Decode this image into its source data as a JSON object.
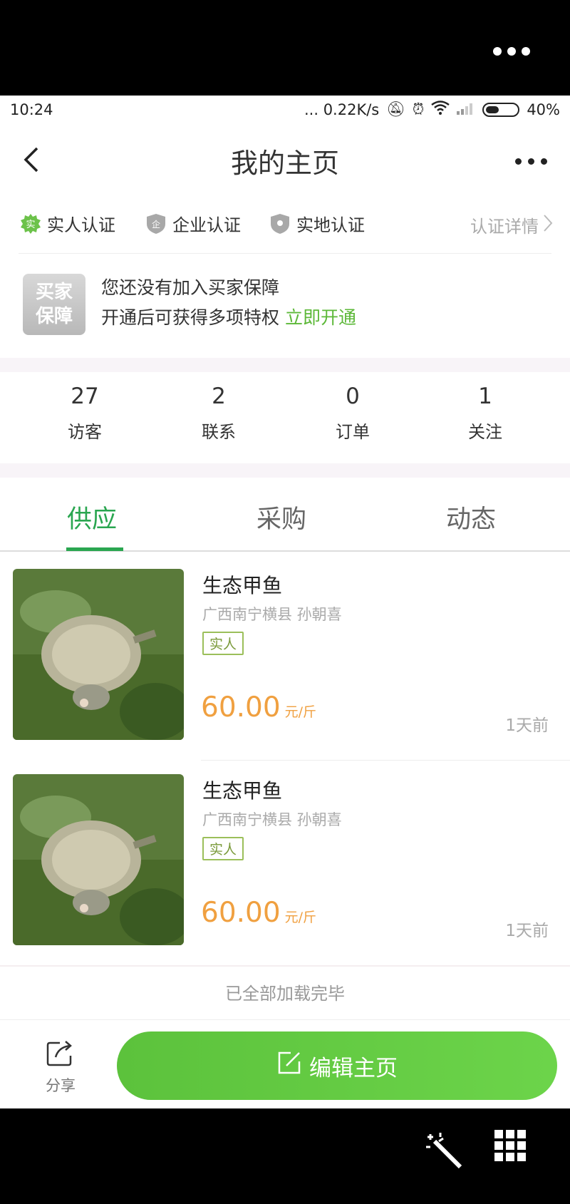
{
  "status_bar": {
    "time": "10:24",
    "network_speed": "... 0.22K/s",
    "battery": "40%"
  },
  "nav": {
    "title": "我的主页"
  },
  "certifications": {
    "items": [
      {
        "badge": "实",
        "label": "实人认证",
        "color": "#6cc24a"
      },
      {
        "badge": "企",
        "label": "企业认证",
        "color": "#a8a8a8"
      },
      {
        "badge": "",
        "label": "实地认证",
        "color": "#a8a8a8"
      }
    ],
    "detail": "认证详情"
  },
  "guarantee": {
    "logo_line1": "买家",
    "logo_line2": "保障",
    "text1": "您还没有加入买家保障",
    "text2": "开通后可获得多项特权",
    "action": "立即开通"
  },
  "stats": [
    {
      "value": "27",
      "label": "访客"
    },
    {
      "value": "2",
      "label": "联系"
    },
    {
      "value": "0",
      "label": "订单"
    },
    {
      "value": "1",
      "label": "关注"
    }
  ],
  "tabs": [
    {
      "label": "供应",
      "active": true
    },
    {
      "label": "采购",
      "active": false
    },
    {
      "label": "动态",
      "active": false
    }
  ],
  "supply_items": [
    {
      "title": "生态甲鱼",
      "location": "广西南宁横县 孙朝喜",
      "tag": "实人",
      "price": "60.00",
      "unit": "元/斤",
      "time": "1天前"
    },
    {
      "title": "生态甲鱼",
      "location": "广西南宁横县 孙朝喜",
      "tag": "实人",
      "price": "60.00",
      "unit": "元/斤",
      "time": "1天前"
    }
  ],
  "list_footer": "已全部加载完毕",
  "bottom_bar": {
    "share_label": "分享",
    "edit_label": "编辑主页"
  },
  "colors": {
    "accent_green": "#2aa650",
    "button_green": "#5cc23c",
    "price_orange": "#f0a040"
  }
}
